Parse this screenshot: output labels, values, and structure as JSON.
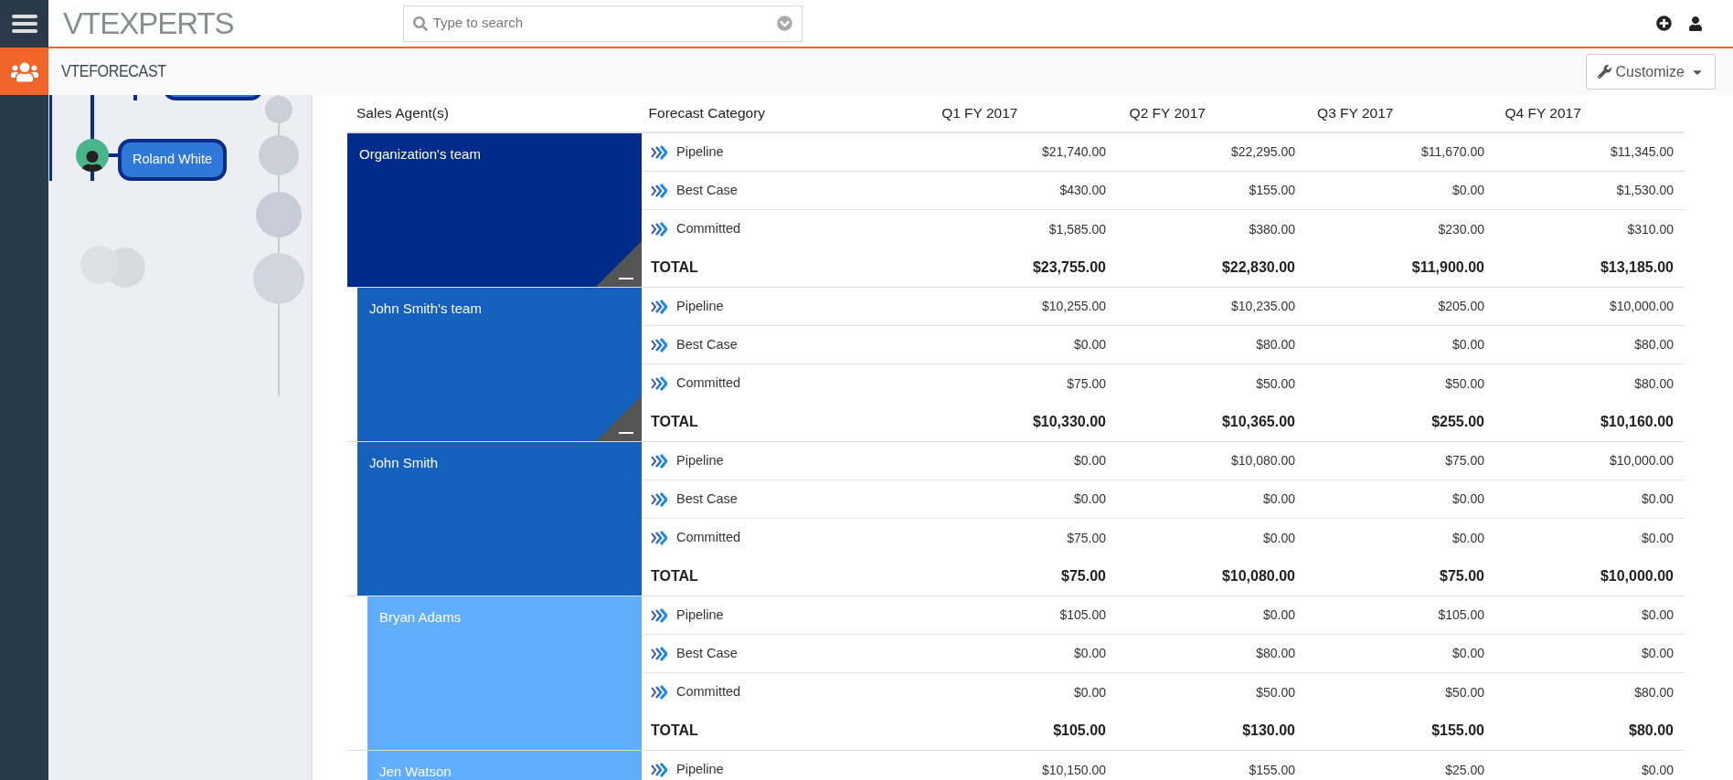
{
  "top_bar": {
    "logo": "VTEXPERTS",
    "search": {
      "placeholder": "Type to search"
    }
  },
  "module_bar": {
    "title": "VTEFORECAST",
    "customize_button": "Customize"
  },
  "tree": {
    "nodes": [
      {
        "name": "Roland White"
      }
    ]
  },
  "table": {
    "columns": [
      "Sales Agent(s)",
      "Forecast Category",
      "Q1 FY 2017",
      "Q2 FY 2017",
      "Q3 FY 2017",
      "Q4 FY 2017"
    ],
    "groups": [
      {
        "name": "Organization's team",
        "collapsible": true,
        "rows": [
          {
            "kind": "category",
            "label": "Pipeline",
            "values": [
              "$21,740.00",
              "$22,295.00",
              "$11,670.00",
              "$11,345.00"
            ]
          },
          {
            "kind": "category",
            "label": "Best Case",
            "values": [
              "$430.00",
              "$155.00",
              "$0.00",
              "$1,530.00"
            ]
          },
          {
            "kind": "category",
            "label": "Committed",
            "values": [
              "$1,585.00",
              "$380.00",
              "$230.00",
              "$310.00"
            ]
          },
          {
            "kind": "total",
            "label": "TOTAL",
            "values": [
              "$23,755.00",
              "$22,830.00",
              "$11,900.00",
              "$13,185.00"
            ]
          }
        ],
        "children": [
          {
            "name": "John Smith's team",
            "collapsible": true,
            "rows": [
              {
                "kind": "category",
                "label": "Pipeline",
                "values": [
                  "$10,255.00",
                  "$10,235.00",
                  "$205.00",
                  "$10,000.00"
                ]
              },
              {
                "kind": "category",
                "label": "Best Case",
                "values": [
                  "$0.00",
                  "$80.00",
                  "$0.00",
                  "$80.00"
                ]
              },
              {
                "kind": "category",
                "label": "Committed",
                "values": [
                  "$75.00",
                  "$50.00",
                  "$50.00",
                  "$80.00"
                ]
              },
              {
                "kind": "total",
                "label": "TOTAL",
                "values": [
                  "$10,330.00",
                  "$10,365.00",
                  "$255.00",
                  "$10,160.00"
                ]
              }
            ]
          },
          {
            "name": "John Smith",
            "collapsible": false,
            "rows": [
              {
                "kind": "category",
                "label": "Pipeline",
                "values": [
                  "$0.00",
                  "$10,080.00",
                  "$75.00",
                  "$10,000.00"
                ]
              },
              {
                "kind": "category",
                "label": "Best Case",
                "values": [
                  "$0.00",
                  "$0.00",
                  "$0.00",
                  "$0.00"
                ]
              },
              {
                "kind": "category",
                "label": "Committed",
                "values": [
                  "$75.00",
                  "$0.00",
                  "$0.00",
                  "$0.00"
                ]
              },
              {
                "kind": "total",
                "label": "TOTAL",
                "values": [
                  "$75.00",
                  "$10,080.00",
                  "$75.00",
                  "$10,000.00"
                ]
              }
            ],
            "children": [
              {
                "name": "Bryan Adams",
                "collapsible": false,
                "rows": [
                  {
                    "kind": "category",
                    "label": "Pipeline",
                    "values": [
                      "$105.00",
                      "$0.00",
                      "$105.00",
                      "$0.00"
                    ]
                  },
                  {
                    "kind": "category",
                    "label": "Best Case",
                    "values": [
                      "$0.00",
                      "$80.00",
                      "$0.00",
                      "$0.00"
                    ]
                  },
                  {
                    "kind": "category",
                    "label": "Committed",
                    "values": [
                      "$0.00",
                      "$50.00",
                      "$50.00",
                      "$80.00"
                    ]
                  },
                  {
                    "kind": "total",
                    "label": "TOTAL",
                    "values": [
                      "$105.00",
                      "$130.00",
                      "$155.00",
                      "$80.00"
                    ]
                  }
                ]
              },
              {
                "name": "Jen Watson",
                "collapsible": false,
                "rows": [
                  {
                    "kind": "category",
                    "label": "Pipeline",
                    "values": [
                      "$10,150.00",
                      "$155.00",
                      "$25.00",
                      "$0.00"
                    ]
                  }
                ]
              }
            ]
          }
        ]
      }
    ]
  }
}
